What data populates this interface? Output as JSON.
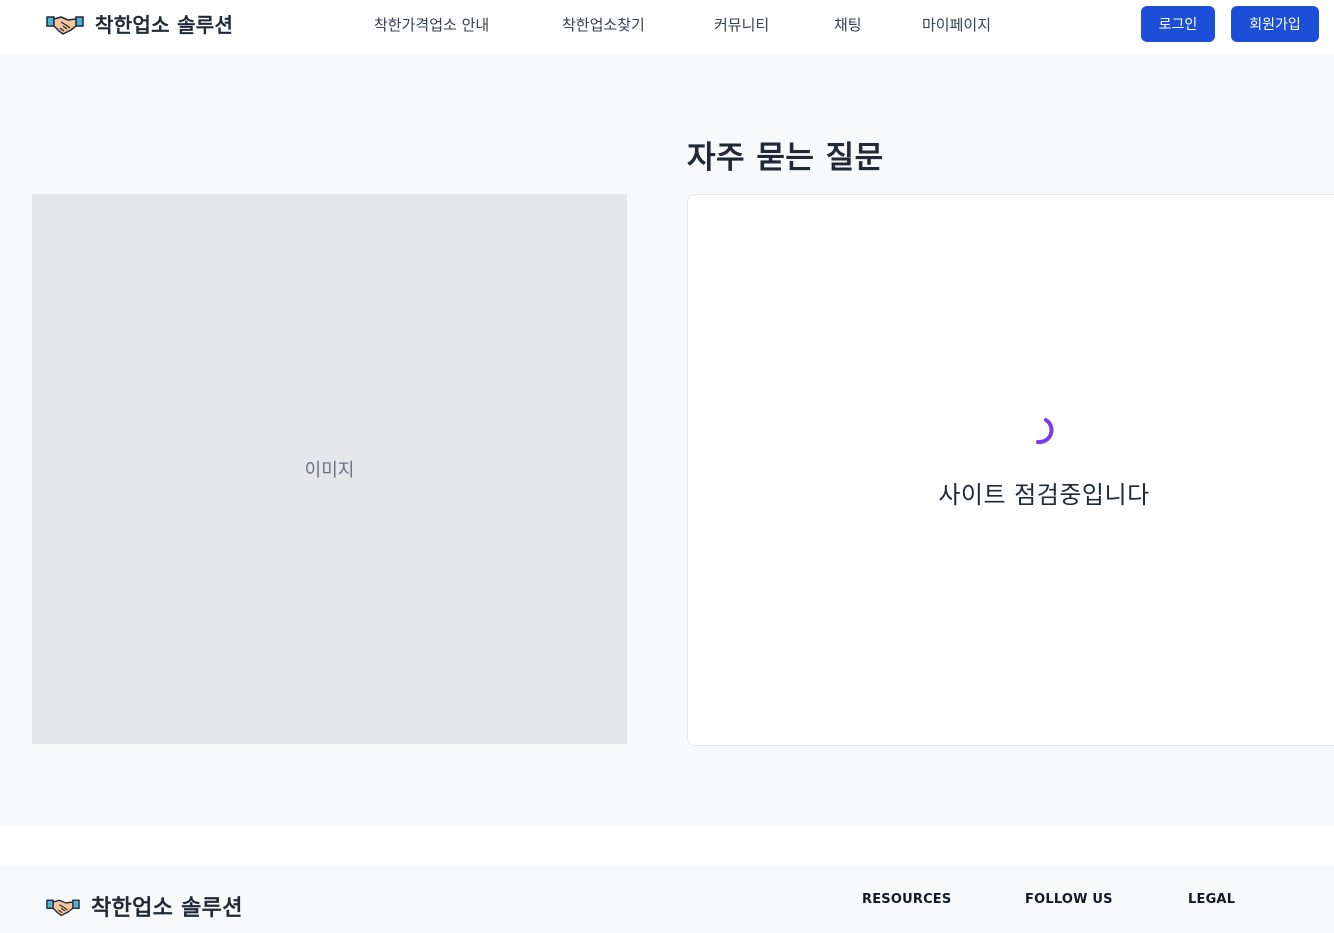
{
  "header": {
    "brand": "착한업소 솔루션",
    "logo_icon": "handshake-icon",
    "nav": [
      {
        "label": "착한가격업소 안내"
      },
      {
        "label": "착한업소찾기"
      },
      {
        "label": "커뮤니티"
      },
      {
        "label": "채팅"
      },
      {
        "label": "마이페이지"
      }
    ],
    "login_label": "로그인",
    "signup_label": "회원가입"
  },
  "main": {
    "image_placeholder": "이미지",
    "faq_title": "자주 묻는 질문",
    "spinner_icon": "loading-spinner-icon",
    "status_text": "사이트 점검중입니다"
  },
  "footer": {
    "brand": "착한업소 솔루션",
    "headings": [
      "RESOURCES",
      "FOLLOW US",
      "LEGAL"
    ]
  },
  "colors": {
    "primary": "#1d4ed8",
    "spinner": "#7c3aed",
    "page_bg": "#f8f9fb",
    "placeholder_bg": "#e5e7eb"
  }
}
